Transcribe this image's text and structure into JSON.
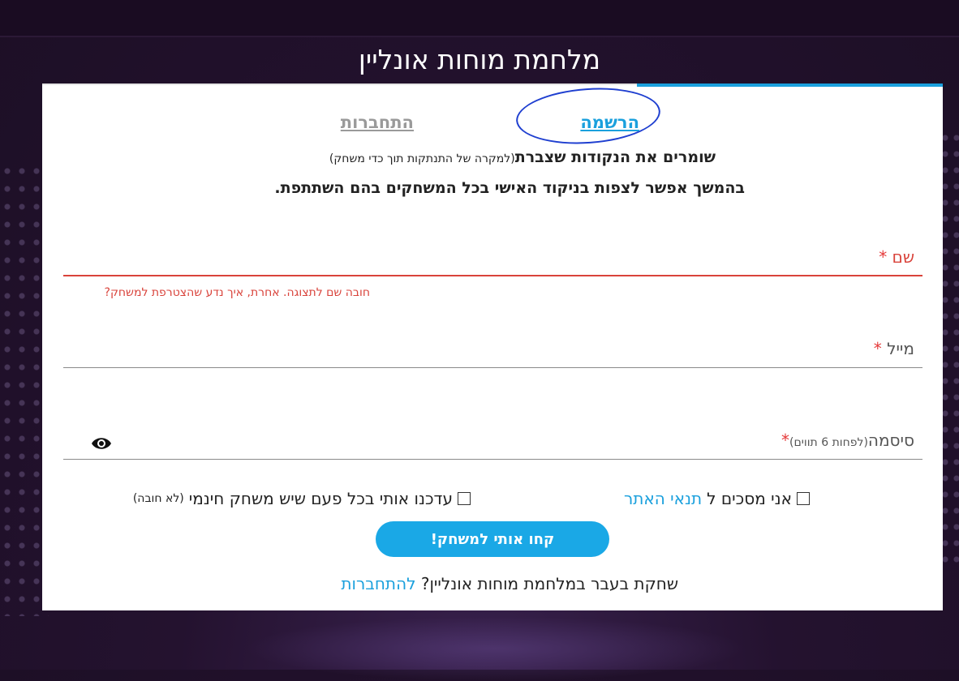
{
  "page": {
    "title": "מלחמת מוחות אונליין"
  },
  "tabs": {
    "register": "הרשמה",
    "login": "התחברות"
  },
  "intro": {
    "line1_bold": "שומרים את הנקודות שצברת",
    "line1_note": "(למקרה של התנתקות תוך כדי משחק)",
    "line2": "בהמשך אפשר לצפות בניקוד האישי בכל המשחקים בהם השתתפת."
  },
  "form": {
    "name_label": "שם",
    "name_error": "חובה שם לתצוגה. אחרת, איך נדע שהצטרפת למשחק?",
    "email_label": "מייל",
    "password_label": "סיסמה",
    "password_hint": "(לפחות 6 תווים)",
    "required_mark": "*"
  },
  "checkboxes": {
    "terms_prefix": "אני מסכים ל",
    "terms_link": "תנאי האתר",
    "updates_label": "עדכנו אותי בכל פעם שיש משחק חינמי",
    "updates_note": "(לא חובה)"
  },
  "submit_label": "קחו אותי למשחק!",
  "footer": {
    "text": "שחקת בעבר במלחמת מוחות אונליין?",
    "link": "להתחברות"
  },
  "colors": {
    "accent": "#1aa0dd",
    "error": "#d9433b",
    "button": "#1aa8e6",
    "annotation": "#1f3fd0"
  },
  "icons": {
    "password_toggle": "eye-icon"
  }
}
